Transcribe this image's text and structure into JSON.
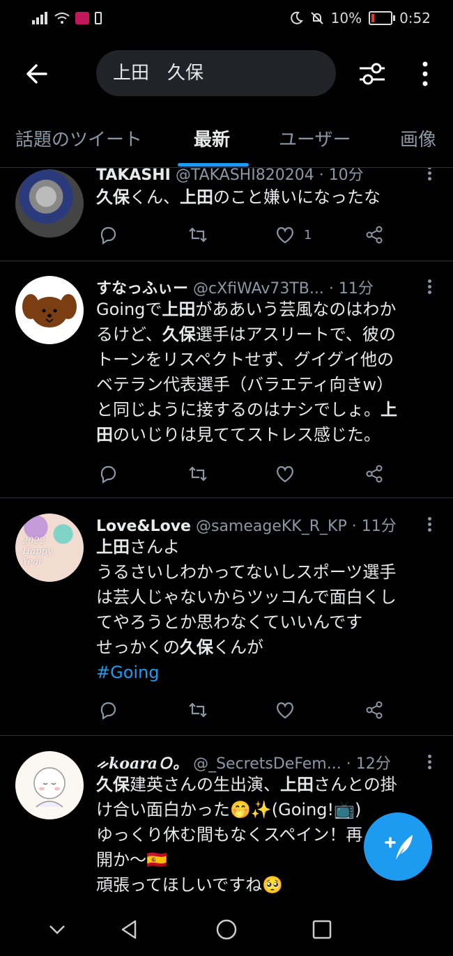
{
  "status": {
    "battery": "10%",
    "time": "0:52"
  },
  "search": {
    "query": "上田　久保"
  },
  "tabs": [
    {
      "label": "話題のツイート",
      "active": false
    },
    {
      "label": "最新",
      "active": true
    },
    {
      "label": "ユーザー",
      "active": false
    },
    {
      "label": "画像",
      "active": false
    }
  ],
  "tweets": [
    {
      "name": "TAKASHI",
      "handle": "@TAKASHI820204",
      "time": "· 10分",
      "lines": [
        [
          {
            "t": "久保",
            "b": true
          },
          {
            "t": "くん、",
            "b": false
          },
          {
            "t": "上田",
            "b": true
          },
          {
            "t": "のこと嫌いになったな",
            "b": false
          }
        ]
      ],
      "likes": "1"
    },
    {
      "name": "すなっふぃー",
      "handle": "@cXfiWAv73TB...",
      "time": "· 11分",
      "lines": [
        [
          {
            "t": "Goingで",
            "b": false
          },
          {
            "t": "上田",
            "b": true
          },
          {
            "t": "がああいう芸風なのはわか",
            "b": false
          }
        ],
        [
          {
            "t": "るけど、",
            "b": false
          },
          {
            "t": "久保",
            "b": true
          },
          {
            "t": "選手はアスリートで、彼の",
            "b": false
          }
        ],
        [
          {
            "t": "トーンをリスペクトせず、グイグイ他の",
            "b": false
          }
        ],
        [
          {
            "t": "ベテラン代表選手（バラエティ向きw）",
            "b": false
          }
        ],
        [
          {
            "t": "と同じように接するのはナシでしょ。",
            "b": false
          },
          {
            "t": "上",
            "b": true
          }
        ],
        [
          {
            "t": "田",
            "b": true
          },
          {
            "t": "のいじりは見ててストレス感じた。",
            "b": false
          }
        ]
      ],
      "likes": ""
    },
    {
      "name": "Love&Love",
      "handle": "@sameageKK_R_KP",
      "time": "· 11分",
      "lines": [
        [
          {
            "t": "上田",
            "b": true
          },
          {
            "t": "さんよ",
            "b": false
          }
        ],
        [
          {
            "t": "うるさいしわかってないしスポーツ選手",
            "b": false
          }
        ],
        [
          {
            "t": "は芸人じゃないからツッコんで面白くし",
            "b": false
          }
        ],
        [
          {
            "t": "てやろうとか思わなくていいんです",
            "b": false
          }
        ],
        [
          {
            "t": "せっかくの",
            "b": false
          },
          {
            "t": "久保",
            "b": true
          },
          {
            "t": "くんが",
            "b": false
          }
        ]
      ],
      "hashtag": "#Going",
      "likes": "",
      "avatar_text": [
        "2022",
        "Happy",
        "Year"
      ]
    },
    {
      "name": "ᨀkoaraＯ。",
      "handle": "@_SecretsDeFem...",
      "time": "· 12分",
      "lines": [
        [
          {
            "t": "久保",
            "b": true
          },
          {
            "t": "建英さんの生出演、",
            "b": false
          },
          {
            "t": "上田",
            "b": true
          },
          {
            "t": "さんとの掛",
            "b": false
          }
        ],
        [
          {
            "t": "け合い面白かった🤭✨(Going!📺)",
            "b": false
          }
        ],
        [
          {
            "t": "ゆっくり休む間もなくスペイン！再",
            "b": false
          }
        ],
        [
          {
            "t": "開か〜🇪🇸",
            "b": false
          }
        ],
        [
          {
            "t": "頑張ってほしいですね🥺",
            "b": false
          }
        ]
      ],
      "likes": ""
    }
  ],
  "colors": {
    "accent": "#1d9bf0",
    "muted": "#8b98a5",
    "background": "#000000"
  }
}
